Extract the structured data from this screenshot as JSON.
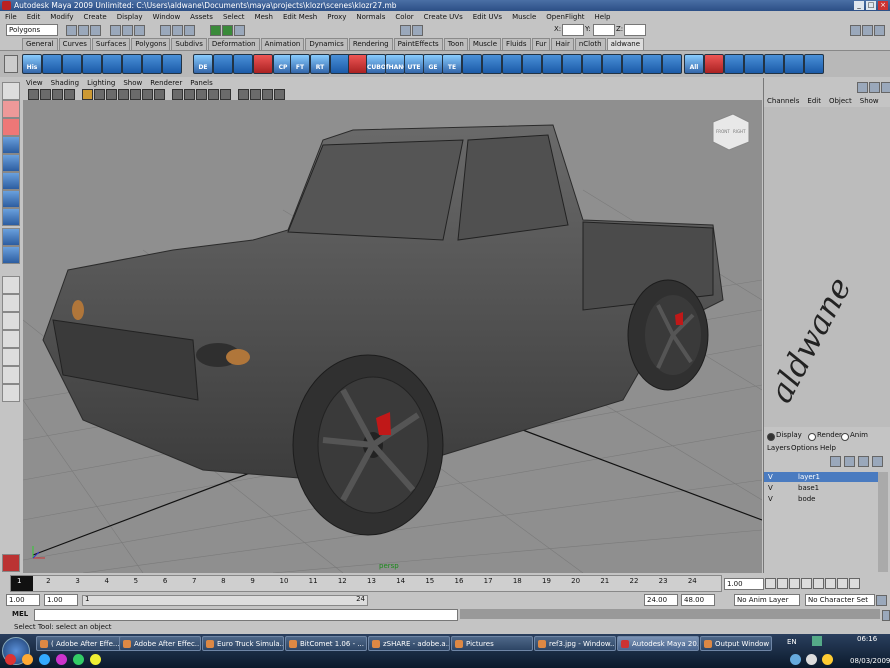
{
  "titlebar": {
    "title": "Autodesk Maya 2009 Unlimited: C:\\Users\\aldwane\\Documents\\maya\\projects\\klozr\\scenes\\klozr27.mb"
  },
  "menu": [
    "File",
    "Edit",
    "Modify",
    "Create",
    "Display",
    "Window",
    "Assets",
    "Select",
    "Mesh",
    "Edit Mesh",
    "Proxy",
    "Normals",
    "Color",
    "Create UVs",
    "Edit UVs",
    "Muscle",
    "OpenFlight",
    "Help"
  ],
  "statusline": {
    "mode": "Polygons",
    "x_label": "X:",
    "y_label": "Y:",
    "z_label": "Z:"
  },
  "shelf_tabs": [
    "General",
    "Curves",
    "Surfaces",
    "Polygons",
    "Subdivs",
    "Deformation",
    "Animation",
    "Dynamics",
    "Rendering",
    "PaintEffects",
    "Toon",
    "Muscle",
    "Fluids",
    "Fur",
    "Hair",
    "nCloth",
    "aldwane"
  ],
  "shelf_active": "aldwane",
  "shelf_labels": [
    "His",
    "DE",
    "CP",
    "FT",
    "RT",
    "CUBO",
    "fHANG",
    "UTE",
    "GE",
    "TE",
    "All"
  ],
  "panel_menu": [
    "View",
    "Shading",
    "Lighting",
    "Show",
    "Renderer",
    "Panels"
  ],
  "viewport": {
    "camera": "persp",
    "viewcube_front": "FRONT",
    "viewcube_right": "RIGHT"
  },
  "signature": "aldwane",
  "channel_menu": [
    "Channels",
    "Edit",
    "Object",
    "Show"
  ],
  "layers": {
    "modes": [
      "Display",
      "Render",
      "Anim"
    ],
    "menu": [
      "Layers",
      "Options",
      "Help"
    ],
    "rows": [
      {
        "v": "V",
        "name": "layer1",
        "selected": true
      },
      {
        "v": "V",
        "name": "base1",
        "selected": false
      },
      {
        "v": "V",
        "name": "bode",
        "selected": false
      }
    ]
  },
  "timeline": {
    "ticks": [
      "1",
      "2",
      "3",
      "4",
      "5",
      "6",
      "7",
      "8",
      "9",
      "10",
      "11",
      "12",
      "13",
      "14",
      "15",
      "16",
      "17",
      "18",
      "19",
      "20",
      "21",
      "22",
      "23",
      "24"
    ],
    "current_frame": "1.00",
    "start": "1.00",
    "start2": "1.00",
    "slider_start": "1",
    "slider_end": "24",
    "end": "24.00",
    "end2": "48.00",
    "anim_layer": "No Anim Layer",
    "char_set": "No Character Set"
  },
  "mel_label": "MEL",
  "help_line": "Select Tool: select an object",
  "taskbar": {
    "tasks": [
      {
        "label": "( Adobe After Effe...",
        "active": false
      },
      {
        "label": "Adobe After Effec...",
        "active": false
      },
      {
        "label": "Euro Truck Simula...",
        "active": false
      },
      {
        "label": "BitComet 1.06 - ...",
        "active": false
      },
      {
        "label": "zSHARE - adobe.a...",
        "active": false
      },
      {
        "label": "Pictures",
        "active": false
      },
      {
        "label": "ref3.jpg - Window...",
        "active": false
      },
      {
        "label": "Autodesk Maya 20...",
        "active": true
      },
      {
        "label": "Output Window",
        "active": false
      }
    ],
    "lang": "EN",
    "time": "06:16",
    "date": "08/03/2009"
  }
}
